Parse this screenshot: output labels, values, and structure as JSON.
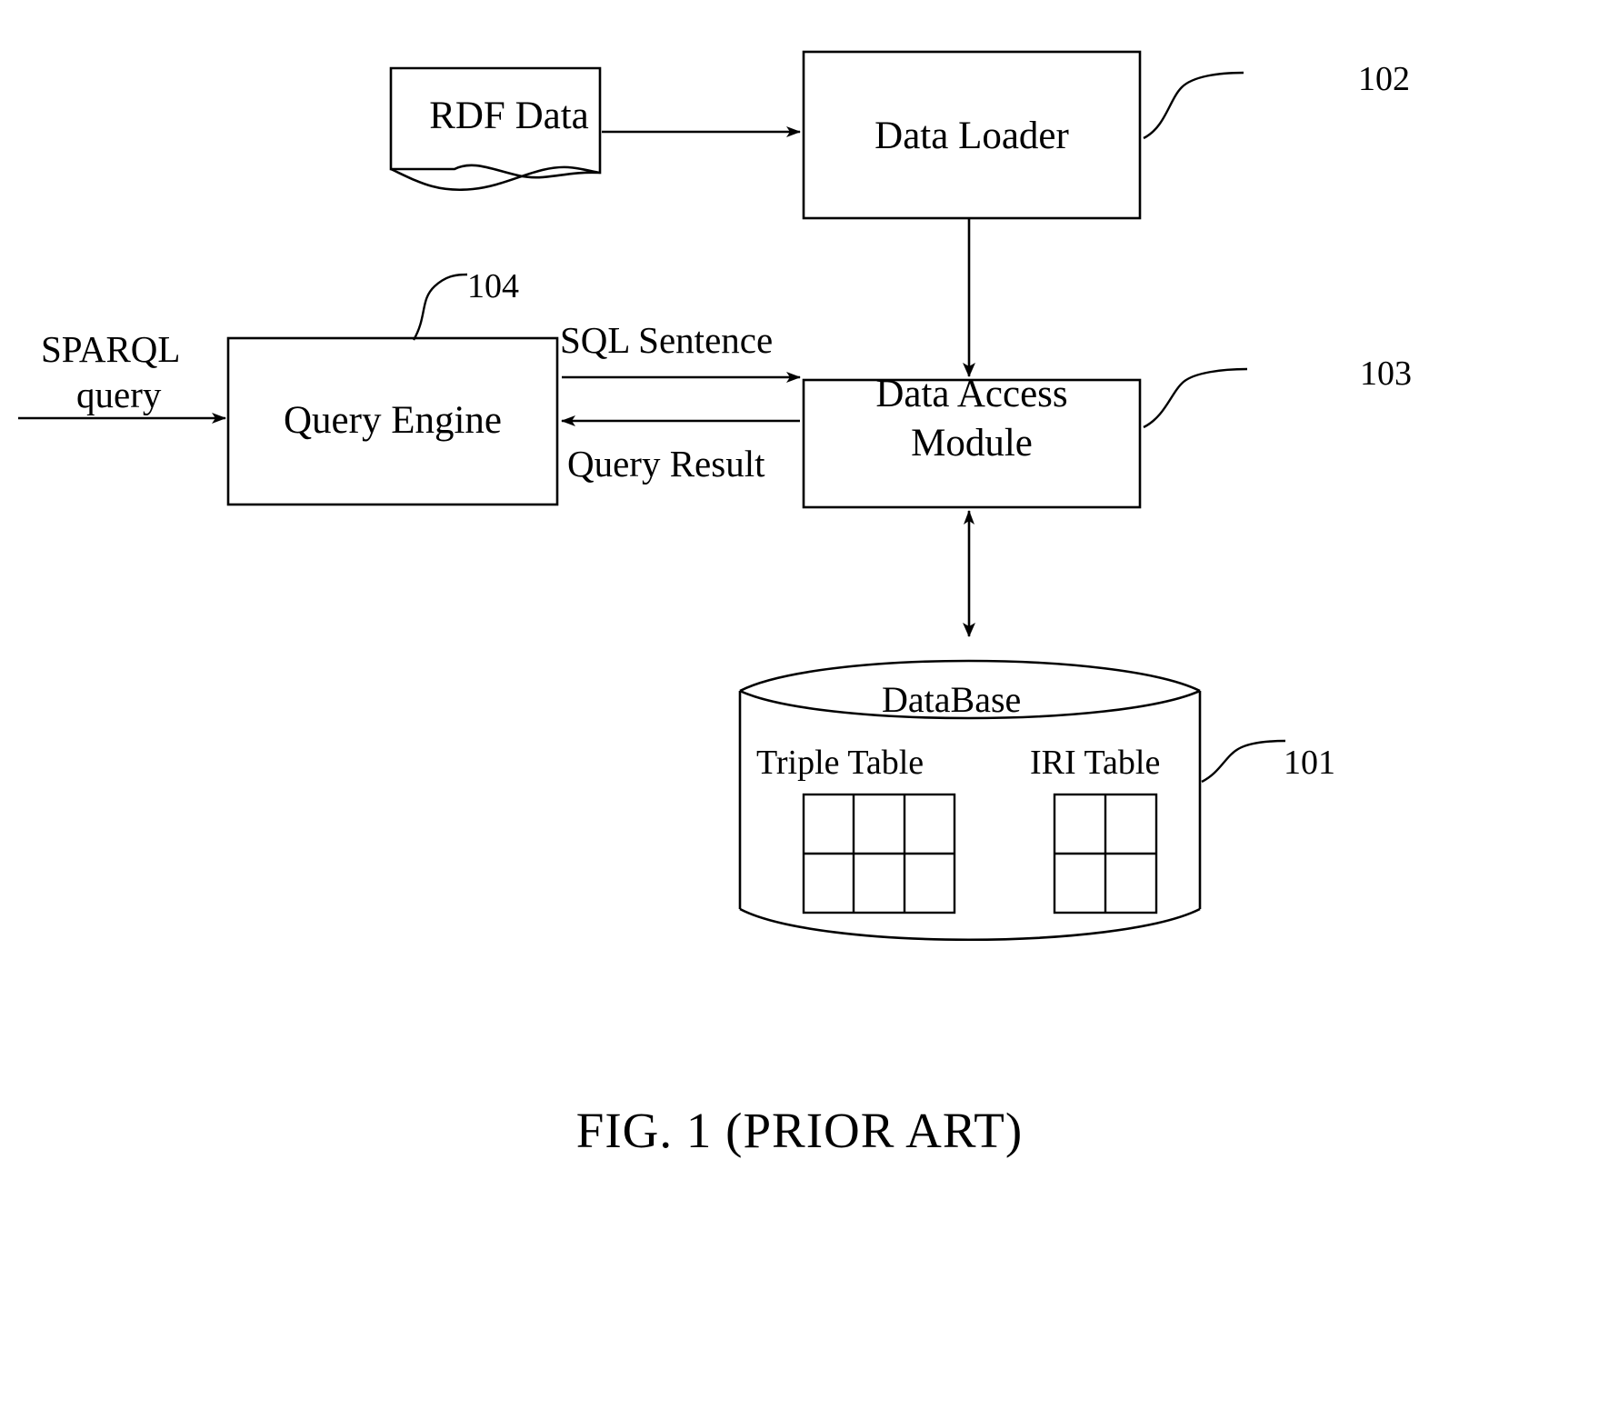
{
  "figure": {
    "caption": "FIG. 1 (PRIOR ART)",
    "domain": "patent-system-architecture-diagram"
  },
  "nodes": {
    "rdf_data": {
      "label": "RDF Data",
      "shape": "document"
    },
    "data_loader": {
      "label": "Data Loader",
      "shape": "rectangle",
      "ref": "102"
    },
    "query_engine": {
      "label": "Query Engine",
      "shape": "rectangle",
      "ref": "104"
    },
    "data_access_module": {
      "label_line1": "Data Access",
      "label_line2": "Module",
      "shape": "rectangle",
      "ref": "103"
    },
    "database": {
      "label": "DataBase",
      "shape": "cylinder",
      "ref": "101"
    }
  },
  "tables": {
    "triple_table": {
      "caption": "Triple Table",
      "columns": 3,
      "rows": 2
    },
    "iri_table": {
      "caption": "IRI Table",
      "columns": 2,
      "rows": 2
    }
  },
  "flows": {
    "sparql_query_line1": "SPARQL",
    "sparql_query_line2": "query",
    "sql_sentence": "SQL Sentence",
    "query_result": "Query Result"
  },
  "reference_numerals": {
    "database": "101",
    "data_loader": "102",
    "data_access_module": "103",
    "query_engine": "104"
  },
  "colors": {
    "ink": "#000000",
    "paper": "#ffffff"
  }
}
